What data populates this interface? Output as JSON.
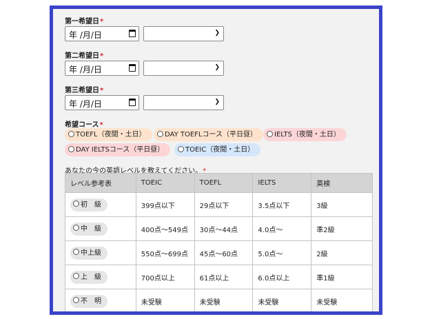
{
  "date_blocks": [
    {
      "label": "第一希望日",
      "date_placeholder": "年 /月/日"
    },
    {
      "label": "第二希望日",
      "date_placeholder": "年 /月/日"
    },
    {
      "label": "第三希望日",
      "date_placeholder": "年 /月/日"
    }
  ],
  "required_mark": "*",
  "course": {
    "label": "希望コース",
    "options": [
      {
        "label": "TOEFL（夜間・土日）"
      },
      {
        "label": "DAY TOEFLコース（平日昼）"
      },
      {
        "label": "IELTS（夜間・土日）"
      },
      {
        "label": "DAY IELTSコース（平日昼）"
      },
      {
        "label": "TOEIC（夜間・土日）"
      }
    ]
  },
  "level": {
    "question": "あなたの今の英語レベルを教えてください。",
    "headers": [
      "レベル参考表",
      "TOEIC",
      "TOEFL",
      "IELTS",
      "英検"
    ],
    "rows": [
      {
        "level": "初　級",
        "toeic": "399点以下",
        "toefl": "29点以下",
        "ielts": "3.5点以下",
        "eiken": "3級"
      },
      {
        "level": "中　級",
        "toeic": "400点〜549点",
        "toefl": "30点〜44点",
        "ielts": "4.0点〜",
        "eiken": "準2級"
      },
      {
        "level": "中上級",
        "toeic": "550点〜699点",
        "toefl": "45点〜60点",
        "ielts": "5.0点〜",
        "eiken": "2級"
      },
      {
        "level": "上　級",
        "toeic": "700点以上",
        "toefl": "61点以上",
        "ielts": "6.0点以上",
        "eiken": "準1級"
      },
      {
        "level": "不　明",
        "toeic": "未受験",
        "toefl": "未受験",
        "ielts": "未受験",
        "eiken": "未受験"
      }
    ]
  },
  "colors": {
    "frame": "#3b43c8",
    "required": "#d8262f",
    "pill_orange": "#fde3cd",
    "pill_pink": "#fcd5d7",
    "pill_blue": "#d6e6fb"
  },
  "icons": {
    "date": "calendar-icon",
    "select": "chevron-down-icon",
    "radio": "radio-circle-icon"
  }
}
